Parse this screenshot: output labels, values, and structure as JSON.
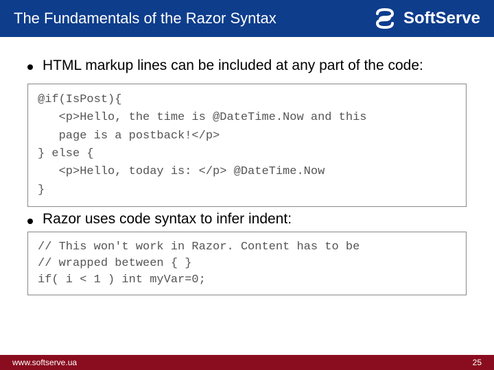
{
  "header": {
    "title": "The Fundamentals of the Razor Syntax",
    "brand": "SoftServe"
  },
  "bullets": {
    "b1": "HTML markup lines can be included at any part of the code:",
    "b2": "Razor uses code syntax to infer indent:"
  },
  "code1": "@if(IsPost){\n   <p>Hello, the time is @DateTime.Now and this\n   page is a postback!</p>\n} else {\n   <p>Hello, today is: </p> @DateTime.Now\n}",
  "code2": "// This won't work in Razor. Content has to be\n// wrapped between { }\nif( i < 1 ) int myVar=0;",
  "footer": {
    "url": "www.softserve.ua",
    "page": "25"
  }
}
